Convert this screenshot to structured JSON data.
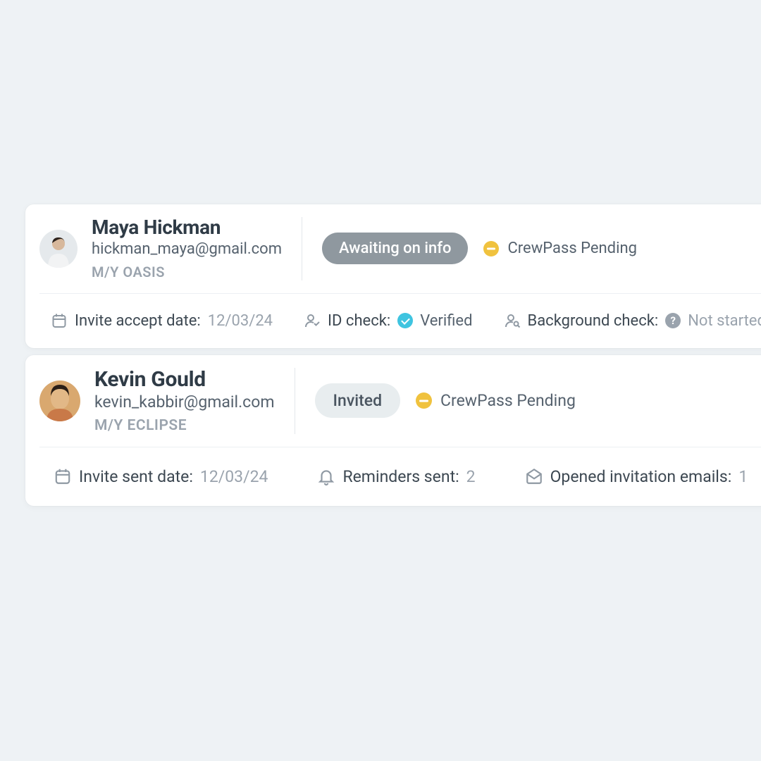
{
  "cards": [
    {
      "name": "Maya Hickman",
      "email": "hickman_maya@gmail.com",
      "vessel": "M/Y OASIS",
      "status_pill": "Awaiting on info",
      "crewpass": "CrewPass Pending",
      "meta": {
        "invite_label": "Invite accept date:",
        "invite_value": "12/03/24",
        "id_label": "ID check:",
        "id_value": "Verified",
        "bg_label": "Background check:",
        "bg_value": "Not started"
      }
    },
    {
      "name": "Kevin Gould",
      "email": "kevin_kabbir@gmail.com",
      "vessel": "M/Y ECLIPSE",
      "status_pill": "Invited",
      "crewpass": "CrewPass Pending",
      "meta": {
        "invite_label": "Invite sent date:",
        "invite_value": "12/03/24",
        "reminders_label": "Reminders sent:",
        "reminders_value": "2",
        "opened_label": "Opened invitation emails:",
        "opened_value": "1"
      }
    }
  ]
}
